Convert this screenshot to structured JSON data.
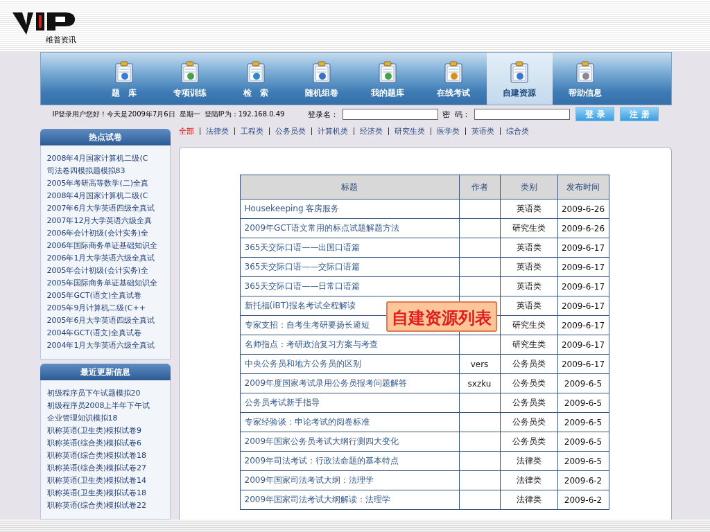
{
  "logo": {
    "caption": "维普资讯"
  },
  "nav": [
    {
      "label": "题　库",
      "selected": false
    },
    {
      "label": "专项训练",
      "selected": false
    },
    {
      "label": "检　索",
      "selected": false
    },
    {
      "label": "随机组卷",
      "selected": false
    },
    {
      "label": "我的题库",
      "selected": false
    },
    {
      "label": "在线考试",
      "selected": false
    },
    {
      "label": "自建资源",
      "selected": true
    },
    {
      "label": "帮助信息",
      "selected": false
    }
  ],
  "login_bar": {
    "greeting": "IP登录用户您好！今天是2009年7月6日",
    "weekday": "星期一",
    "ip": "登陆IP为：192.168.0.49",
    "username_label": "登录名：",
    "password_label": "密  码：",
    "buttons": [
      "登 录",
      "注 册"
    ]
  },
  "sidebar": [
    {
      "title": "热点试卷",
      "items": [
        "2008年4月国家计算机二级(C",
        "司法卷四模拟题模拟83",
        "2005年考研高等数学(二)全真",
        "2008年4月国家计算机二级(C",
        "2007年6月大学英语四级全真试",
        "2007年12月大学英语六级全真",
        "2006年会计初级(会计实务)全",
        "2006年国际商务单证基础知识全",
        "2006年1月大学英语六级全真试",
        "2005年会计初级(会计实务)全",
        "2005年国际商务单证基础知识全",
        "2005年GCT(语文)全真试卷",
        "2005年9月计算机二级(C++",
        "2005年6月大学英语四级全真试",
        "2004年GCT(语文)全真试卷",
        "2004年1月大学英语六级全真试"
      ]
    },
    {
      "title": "最近更新信息",
      "items": [
        "初级程序员下午试题模拟20",
        "初级程序员2008上半年下午试",
        "企业管理知识模拟18",
        "职称英语(卫生类)模拟试卷9",
        "职称英语(综合类)模拟试卷6",
        "职称英语(综合类)模拟试卷18",
        "职称英语(综合类)模拟试卷27",
        "职称英语(卫生类)模拟试卷14",
        "职称英语(卫生类)模拟试卷18",
        "职称英语(综合类)模拟试卷22"
      ]
    }
  ],
  "filters": [
    {
      "label": "全部",
      "selected": true
    },
    {
      "label": "法律类",
      "selected": false
    },
    {
      "label": "工程类",
      "selected": false
    },
    {
      "label": "公务员类",
      "selected": false
    },
    {
      "label": "计算机类",
      "selected": false
    },
    {
      "label": "经济类",
      "selected": false
    },
    {
      "label": "研究生类",
      "selected": false
    },
    {
      "label": "医学类",
      "selected": false
    },
    {
      "label": "英语类",
      "selected": false
    },
    {
      "label": "综合类",
      "selected": false
    }
  ],
  "table": {
    "columns": [
      "标题",
      "作者",
      "类别",
      "发布时间"
    ],
    "rows": [
      {
        "title": "Housekeeping 客房服务",
        "author": "",
        "category": "英语类",
        "date": "2009-6-26"
      },
      {
        "title": "2009年GCT语文常用的标点试题解题方法",
        "author": "",
        "category": "研究生类",
        "date": "2009-6-26"
      },
      {
        "title": "365天交际口语——出国口语篇",
        "author": "",
        "category": "英语类",
        "date": "2009-6-17"
      },
      {
        "title": "365天交际口语——交际口语篇",
        "author": "",
        "category": "英语类",
        "date": "2009-6-17"
      },
      {
        "title": "365天交际口语——日常口语篇",
        "author": "",
        "category": "英语类",
        "date": "2009-6-17"
      },
      {
        "title": "新托福(iBT)报名考试全程解读",
        "author": "",
        "category": "英语类",
        "date": "2009-6-17"
      },
      {
        "title": "专家支招：自考生考研要扬长避短",
        "author": "",
        "category": "研究生类",
        "date": "2009-6-17"
      },
      {
        "title": "名师指点：考研政治复习方案与考查",
        "author": "",
        "category": "研究生类",
        "date": "2009-6-17"
      },
      {
        "title": "中央公务员和地方公务员的区别",
        "author": "vers",
        "category": "公务员类",
        "date": "2009-6-17"
      },
      {
        "title": "2009年度国家考试录用公务员报考问题解答",
        "author": "sxzku",
        "category": "公务员类",
        "date": "2009-6-5"
      },
      {
        "title": "公务员考试新手指导",
        "author": "",
        "category": "公务员类",
        "date": "2009-6-5"
      },
      {
        "title": "专家经验谈：申论考试的阅卷标准",
        "author": "",
        "category": "公务员类",
        "date": "2009-6-5"
      },
      {
        "title": "2009年国家公务员考试大纲行测四大变化",
        "author": "",
        "category": "公务员类",
        "date": "2009-6-5"
      },
      {
        "title": "2009年司法考试：行政法命题的基本特点",
        "author": "",
        "category": "法律类",
        "date": "2009-6-5"
      },
      {
        "title": "2009年国家司法考试大纲：法理学",
        "author": "",
        "category": "法律类",
        "date": "2009-6-2"
      },
      {
        "title": "2009年国家司法考试大纲解读：法理学",
        "author": "",
        "category": "法律类",
        "date": "2009-6-2"
      }
    ]
  },
  "callout": {
    "text": "自建资源列表"
  }
}
